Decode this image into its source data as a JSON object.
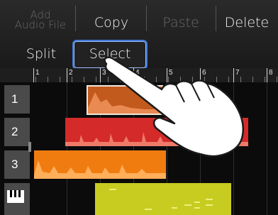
{
  "menu": {
    "add_audio_file_line1": "Add",
    "add_audio_file_line2": "Audio File",
    "copy": "Copy",
    "paste": "Paste",
    "delete": "Delete",
    "split": "Split",
    "select": "Select"
  },
  "ruler": {
    "numbers": [
      "1",
      "2",
      "3",
      "4",
      "5",
      "6",
      "7",
      "8"
    ]
  },
  "tracks": [
    {
      "label": "1",
      "color": "#c25a1e"
    },
    {
      "label": "2",
      "color": "#d42a2a"
    },
    {
      "label": "3",
      "color": "#f07c10"
    },
    {
      "label": "",
      "icon": "piano-keys-icon",
      "color": "#c8cc20"
    }
  ],
  "colors": {
    "select_highlight": "#3e78d6",
    "background": "#0b0b0b"
  }
}
